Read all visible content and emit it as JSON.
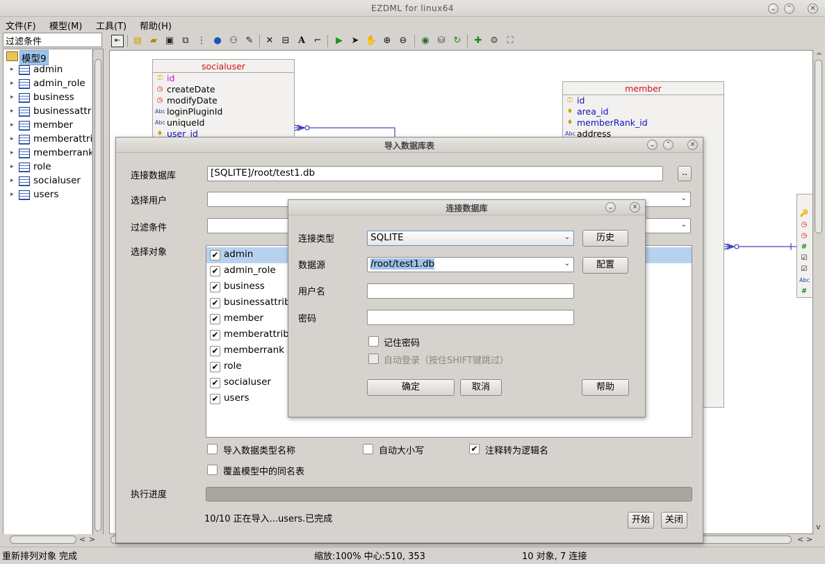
{
  "window": {
    "title": "EZDML for linux64"
  },
  "menu": [
    "文件(F)",
    "模型(M)",
    "工具(T)",
    "帮助(H)"
  ],
  "left": {
    "filter_value": "过滤条件",
    "root": "模型9",
    "tables": [
      "admin",
      "admin_role",
      "business",
      "businessattri",
      "member",
      "memberattrib",
      "memberrank",
      "role",
      "socialuser",
      "users"
    ]
  },
  "canvas": {
    "socialuser": {
      "name": "socialuser",
      "fields": [
        {
          "name": "id",
          "icon": "key-icon",
          "color": "#d010d0"
        },
        {
          "name": "createDate",
          "icon": "clock-icon",
          "color": "#000000"
        },
        {
          "name": "modifyDate",
          "icon": "clock-icon",
          "color": "#000000"
        },
        {
          "name": "loginPluginId",
          "icon": "abc-icon",
          "color": "#000000"
        },
        {
          "name": "uniqueId",
          "icon": "abc-icon",
          "color": "#000000"
        },
        {
          "name": "user_id",
          "icon": "fk-icon",
          "color": "#1010c0"
        }
      ]
    },
    "member": {
      "name": "member",
      "fields": [
        {
          "name": "id",
          "icon": "key-icon",
          "color": "#1010c0"
        },
        {
          "name": "area_id",
          "icon": "fk-icon",
          "color": "#1010c0"
        },
        {
          "name": "memberRank_id",
          "icon": "fk-icon",
          "color": "#1010c0"
        },
        {
          "name": "address",
          "icon": "abc-icon",
          "color": "#000000"
        }
      ]
    }
  },
  "status": {
    "left": "重新排列对象 完成",
    "zoom": "缩放:100% 中心:510, 353",
    "count": "10 对象, 7 连接"
  },
  "import_dialog": {
    "title": "导入数据库表",
    "lbl_conn": "连接数据库",
    "conn_value": "[SQLITE]/root/test1.db",
    "browse": "..",
    "lbl_user": "选择用户",
    "lbl_filter": "过滤条件",
    "lbl_objects": "选择对象",
    "objects": [
      "admin",
      "admin_role",
      "business",
      "businessattrib",
      "member",
      "memberattribu",
      "memberrank",
      "role",
      "socialuser",
      "users"
    ],
    "opt_import_types": "导入数据类型名称",
    "opt_auto_case": "自动大小写",
    "opt_comment_logic": "注释转为逻辑名",
    "opt_overwrite": "覆盖模型中的同名表",
    "lbl_progress": "执行进度",
    "progress": 1.0,
    "progress_text": "10/10 正在导入...users.已完成",
    "btn_start": "开始",
    "btn_close": "关闭"
  },
  "connect_dialog": {
    "title": "连接数据库",
    "lbl_type": "连接类型",
    "type_value": "SQLITE",
    "btn_history": "历史",
    "lbl_source": "数据源",
    "source_value": "/root/test1.db",
    "btn_config": "配置",
    "lbl_username": "用户名",
    "username_value": "",
    "lbl_password": "密码",
    "password_value": "",
    "remember_pwd": "记住密码",
    "auto_login": "自动登录（按住SHIFT键跳过）",
    "btn_ok": "确定",
    "btn_cancel": "取消",
    "btn_help": "帮助"
  }
}
